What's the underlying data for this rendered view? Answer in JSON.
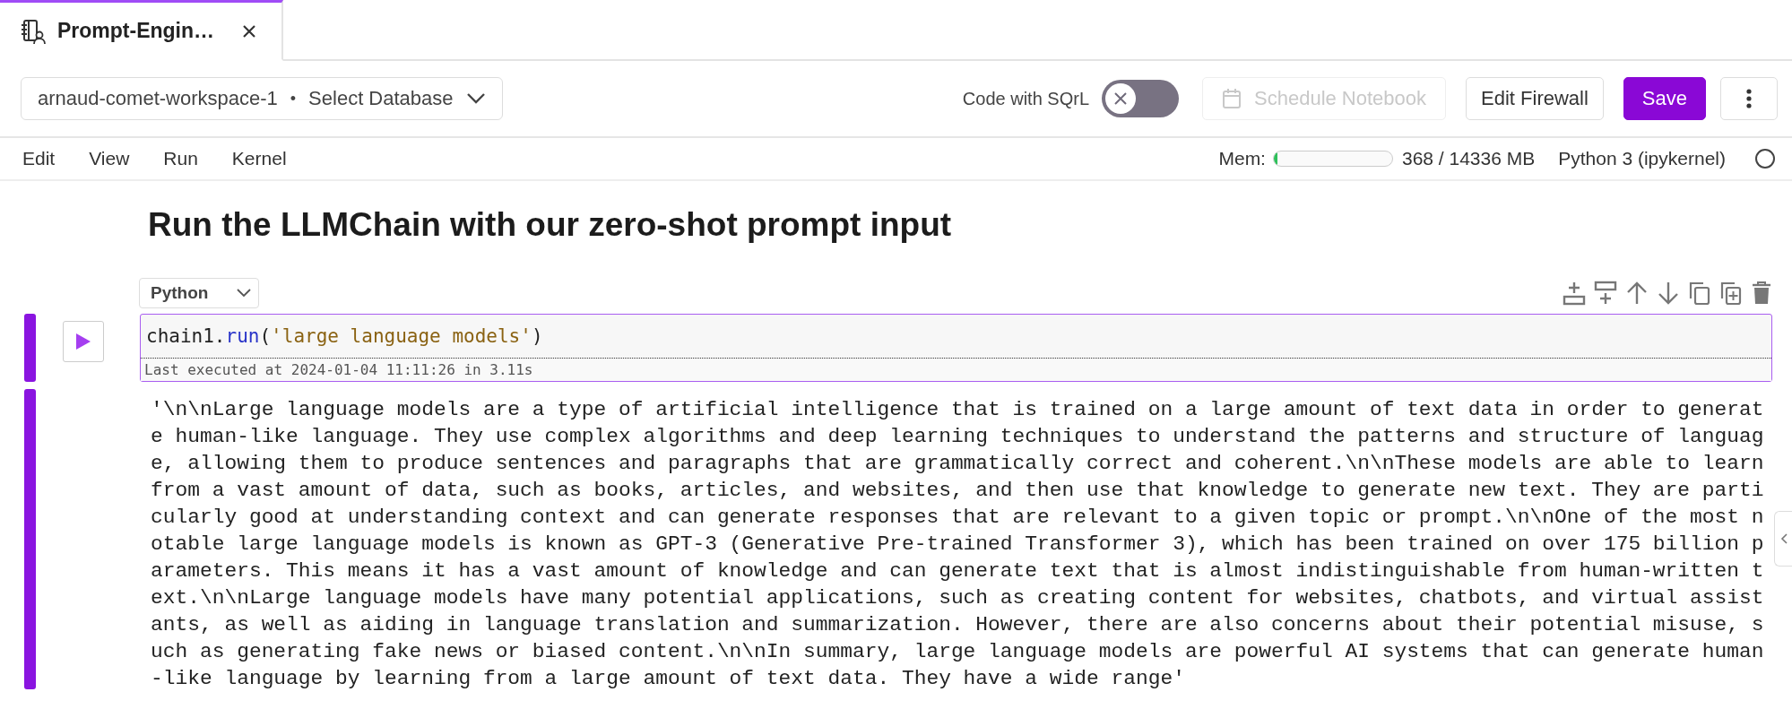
{
  "tabs": [
    {
      "label": "Prompt-Engin…",
      "selected": true
    }
  ],
  "toolbar": {
    "workspace": "arnaud-comet-workspace-1",
    "separator": "•",
    "database": "Select Database",
    "sqrl": {
      "label": "Code with SQrL",
      "on": false
    },
    "buttons": [
      {
        "kind": "schedule",
        "label": "Schedule Notebook",
        "disabled": true
      },
      {
        "kind": "plain",
        "label": "Edit Firewall",
        "disabled": false
      },
      {
        "kind": "primary",
        "label": "Save",
        "disabled": false
      },
      {
        "kind": "more"
      }
    ]
  },
  "menu": [
    "Edit",
    "View",
    "Run",
    "Kernel"
  ],
  "status": {
    "mem_label": "Mem:",
    "level": 0.03,
    "reading": "368 / 14336 MB",
    "kernel": "Python 3 (ipykernel)",
    "busy": false
  },
  "heading": "Run the LLMChain with our zero-shot prompt input",
  "cell": {
    "language": "Python",
    "selected": true,
    "code": [
      {
        "kind": "name",
        "text": "chain1"
      },
      {
        "kind": "punct",
        "text": "."
      },
      {
        "kind": "call",
        "text": "run"
      },
      {
        "kind": "punct",
        "text": "("
      },
      {
        "kind": "string",
        "text": "'large language models'"
      },
      {
        "kind": "punct",
        "text": ")"
      }
    ],
    "exec": "Last executed at 2024-01-04 11:11:26 in 3.11s",
    "output": "'\\n\\nLarge language models are a type of artificial intelligence that is trained on a large amount of text data in order to generate human-like language. They use complex algorithms and deep learning techniques to understand the patterns and structure of language, allowing them to produce sentences and paragraphs that are grammatically correct and coherent.\\n\\nThese models are able to learn from a vast amount of data, such as books, articles, and websites, and then use that knowledge to generate new text. They are particularly good at understanding context and can generate responses that are relevant to a given topic or prompt.\\n\\nOne of the most notable large language models is known as GPT-3 (Generative Pre-trained Transformer 3), which has been trained on over 175 billion parameters. This means it has a vast amount of knowledge and can generate text that is almost indistinguishable from human-written text.\\n\\nLarge language models have many potential applications, such as creating content for websites, chatbots, and virtual assistants, as well as aiding in language translation and summarization. However, there are also concerns about their potential misuse, such as generating fake news or biased content.\\n\\nIn summary, large language models are powerful AI systems that can generate human-like language by learning from a large amount of text data. They have a wide range'"
  }
}
